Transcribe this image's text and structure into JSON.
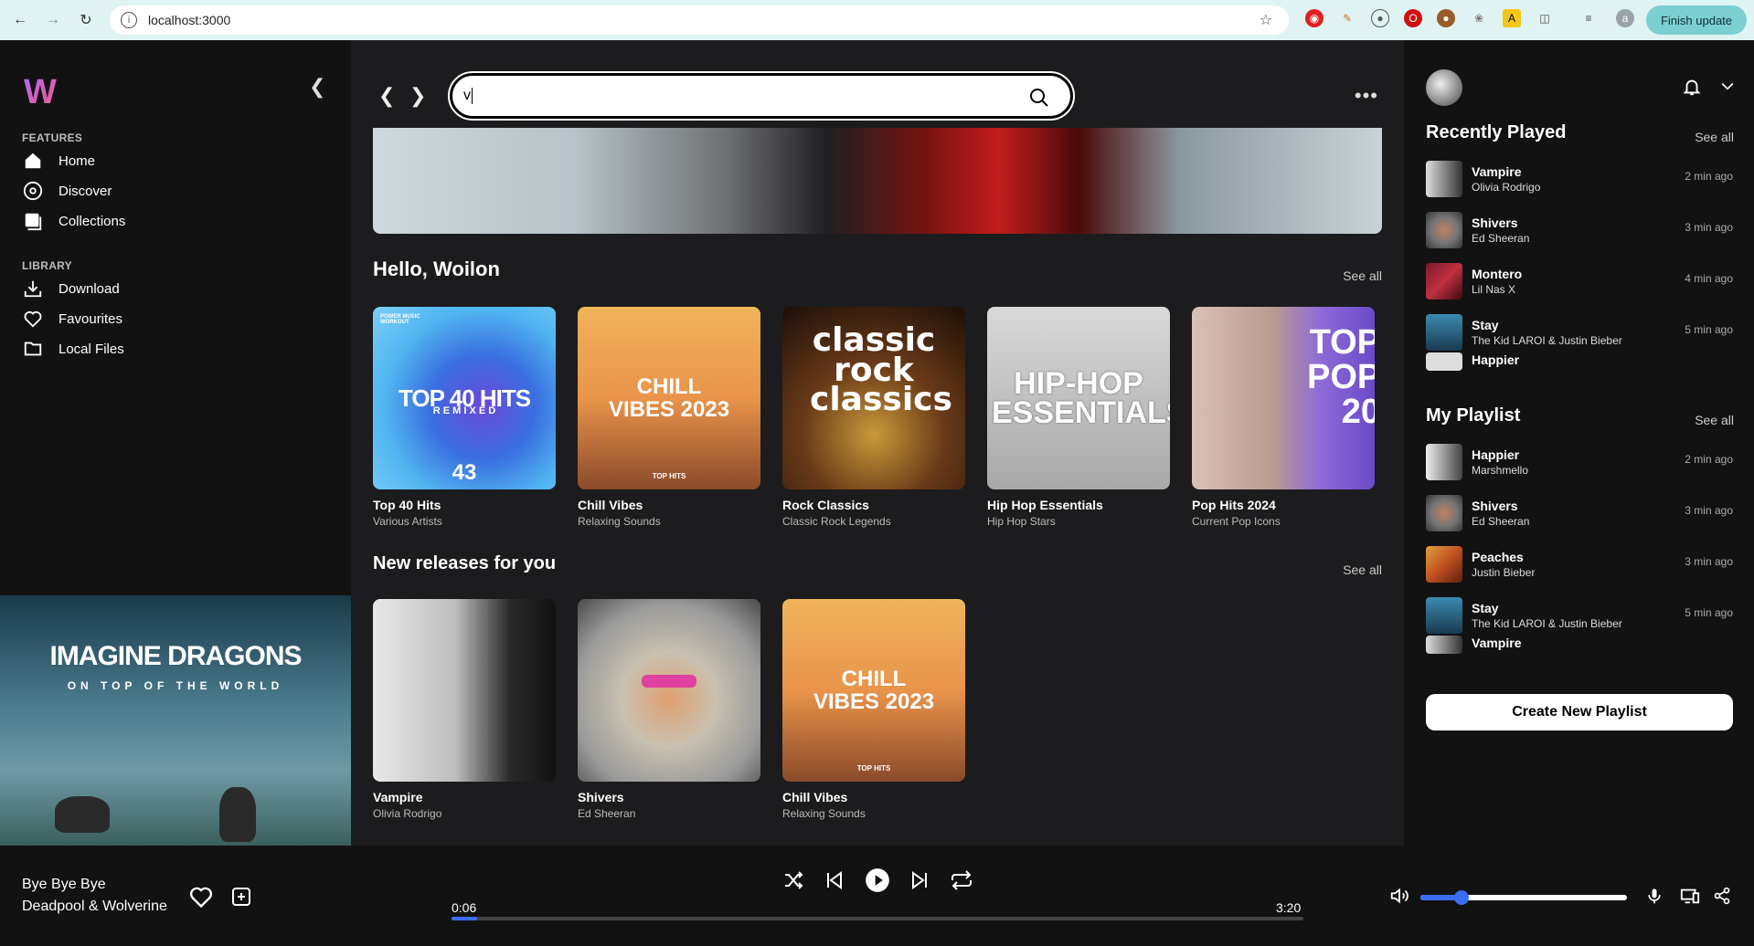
{
  "browser": {
    "url": "localhost:3000",
    "profile_initial": "a",
    "finish_update_label": "Finish update"
  },
  "sidebar": {
    "logo": "W",
    "features_label": "FEATURES",
    "features": [
      {
        "label": "Home",
        "icon": "home-icon"
      },
      {
        "label": "Discover",
        "icon": "compass-icon"
      },
      {
        "label": "Collections",
        "icon": "collections-icon"
      }
    ],
    "library_label": "LIBRARY",
    "library": [
      {
        "label": "Download",
        "icon": "download-icon"
      },
      {
        "label": "Favourites",
        "icon": "heart-icon"
      },
      {
        "label": "Local Files",
        "icon": "folder-icon"
      }
    ],
    "banner": {
      "title": "IMAGINE DRAGONS",
      "subtitle": "ON TOP OF THE WORLD"
    }
  },
  "main": {
    "search_value": "v",
    "greeting": "Hello, Woilon",
    "see_all": "See all",
    "featured": [
      {
        "title": "Top 40 Hits",
        "subtitle": "Various Artists",
        "art_text": "TOP 40 HITS",
        "art_sub": "R E M I X E D",
        "art_tag": "POWER MUSIC WORKOUT",
        "art_vol": "43"
      },
      {
        "title": "Chill Vibes",
        "subtitle": "Relaxing Sounds",
        "art_text": "CHILL VIBES 2023",
        "art_tag": "TOP HITS"
      },
      {
        "title": "Rock Classics",
        "subtitle": "Classic Rock Legends",
        "art_text": "classic rock classics"
      },
      {
        "title": "Hip Hop Essentials",
        "subtitle": "Hip Hop Stars",
        "art_text": "HIP-HOP ESSENTIALS"
      },
      {
        "title": "Pop Hits 2024",
        "subtitle": "Current Pop Icons",
        "art_text": "TOP POP 20"
      }
    ],
    "new_releases_title": "New releases for you",
    "new_releases": [
      {
        "title": "Vampire",
        "subtitle": "Olivia Rodrigo"
      },
      {
        "title": "Shivers",
        "subtitle": "Ed Sheeran"
      },
      {
        "title": "Chill Vibes",
        "subtitle": "Relaxing Sounds",
        "art_text": "CHILL VIBES 2023",
        "art_tag": "TOP HITS"
      }
    ]
  },
  "right": {
    "recently_played_title": "Recently Played",
    "see_all": "See all",
    "recent": [
      {
        "title": "Vampire",
        "artist": "Olivia Rodrigo",
        "time": "2 min ago"
      },
      {
        "title": "Shivers",
        "artist": "Ed Sheeran",
        "time": "3 min ago"
      },
      {
        "title": "Montero",
        "artist": "Lil Nas X",
        "time": "4 min ago"
      },
      {
        "title": "Stay",
        "artist": "The Kid LAROI & Justin Bieber",
        "time": "5 min ago"
      },
      {
        "title": "Happier",
        "artist": "",
        "time": ""
      }
    ],
    "playlist_title": "My Playlist",
    "playlist": [
      {
        "title": "Happier",
        "artist": "Marshmello",
        "time": "2 min ago"
      },
      {
        "title": "Shivers",
        "artist": "Ed Sheeran",
        "time": "3 min ago"
      },
      {
        "title": "Peaches",
        "artist": "Justin Bieber",
        "time": "3 min ago"
      },
      {
        "title": "Stay",
        "artist": "The Kid LAROI & Justin Bieber",
        "time": "5 min ago"
      },
      {
        "title": "Vampire",
        "artist": "",
        "time": ""
      }
    ],
    "create_playlist_label": "Create New Playlist"
  },
  "player": {
    "track_title": "Bye Bye Bye",
    "track_artist": "Deadpool & Wolverine",
    "elapsed": "0:06",
    "duration": "3:20",
    "progress_fraction": 0.03,
    "volume_fraction": 0.2,
    "accent_color": "#3b6cf6"
  }
}
